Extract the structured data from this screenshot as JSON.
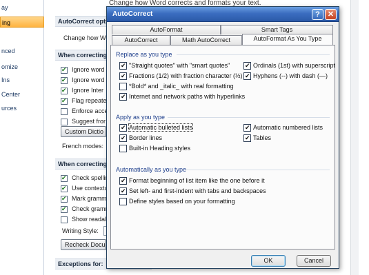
{
  "background": {
    "header_text": "Change how Word corrects and formats your text.",
    "nav_items": [
      "ay",
      "ing",
      "nced",
      "omize",
      "Ins",
      "Center",
      "urces"
    ],
    "autocorrect_section": "AutoCorrect options",
    "autocorrect_row": "Change how Wo",
    "when_correcting_1": "When correcting",
    "options_1": [
      {
        "label": "Ignore word",
        "checked": true
      },
      {
        "label": "Ignore word",
        "checked": true
      },
      {
        "label": "Ignore Inter",
        "checked": true
      },
      {
        "label": "Flag repeate",
        "checked": true
      },
      {
        "label": "Enforce acce",
        "checked": false
      },
      {
        "label": "Suggest fror",
        "checked": false
      }
    ],
    "custom_dict_button": "Custom Dictio",
    "french_modes": "French modes:",
    "when_correcting_2": "When correcting",
    "options_2": [
      {
        "label": "Check spellin",
        "checked": true
      },
      {
        "label": "Use contextu",
        "checked": true
      },
      {
        "label": "Mark gramm",
        "checked": true
      },
      {
        "label": "Check gramm",
        "checked": true
      },
      {
        "label": "Show readal",
        "checked": false
      }
    ],
    "writing_style": "Writing Style:",
    "recheck_button": "Recheck Docu",
    "exceptions": "Exceptions for:"
  },
  "dialog": {
    "title": "AutoCorrect",
    "help_glyph": "?",
    "close_glyph": "✕",
    "tabs_back": [
      "AutoFormat",
      "Smart Tags"
    ],
    "tabs_front": [
      "AutoCorrect",
      "Math AutoCorrect",
      "AutoFormat As You Type"
    ],
    "groups": {
      "replace": {
        "label": "Replace as you type",
        "left": [
          {
            "label": "\"Straight quotes\" with \"smart quotes\"",
            "checked": true
          },
          {
            "label": "Fractions (1/2) with fraction character (½)",
            "checked": true
          },
          {
            "label": "*Bold* and _italic_ with real formatting",
            "checked": false
          },
          {
            "label": "Internet and network paths with hyperlinks",
            "checked": true
          }
        ],
        "right": [
          {
            "label": "Ordinals (1st) with superscript",
            "checked": true
          },
          {
            "label": "Hyphens (--) with dash (—)",
            "checked": true
          }
        ]
      },
      "apply": {
        "label": "Apply as you type",
        "left": [
          {
            "label": "Automatic bulleted lists",
            "checked": true
          },
          {
            "label": "Border lines",
            "checked": true
          },
          {
            "label": "Built-in Heading styles",
            "checked": false
          }
        ],
        "right": [
          {
            "label": "Automatic numbered lists",
            "checked": true
          },
          {
            "label": "Tables",
            "checked": true
          }
        ]
      },
      "auto": {
        "label": "Automatically as you type",
        "items": [
          {
            "label": "Format beginning of list item like the one before it",
            "checked": true
          },
          {
            "label": "Set left- and first-indent with tabs and backspaces",
            "checked": true
          },
          {
            "label": "Define styles based on your formatting",
            "checked": false
          }
        ]
      }
    },
    "ok_label": "OK",
    "cancel_label": "Cancel"
  }
}
